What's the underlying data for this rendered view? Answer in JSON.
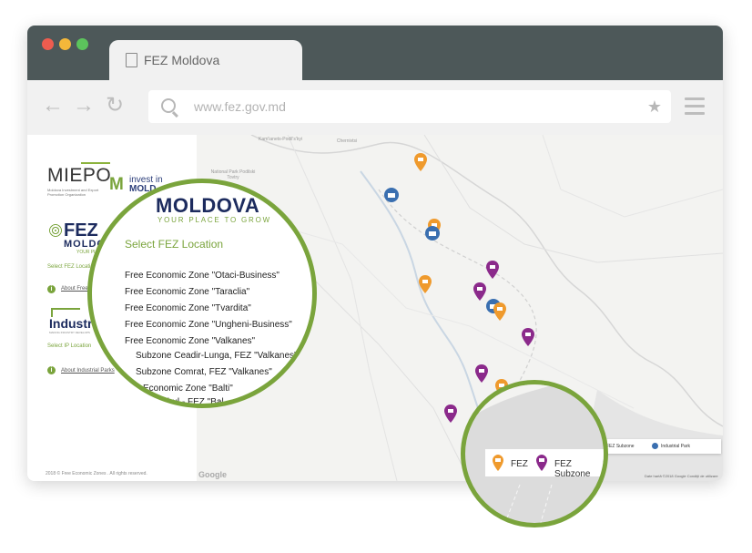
{
  "browser": {
    "tab_title": "FEZ Moldova",
    "url": "www.fez.gov.md",
    "dot_colors": [
      "#ee5c4f",
      "#f4b73a",
      "#5cc45c"
    ]
  },
  "sidebar": {
    "miepo_logo": "MIEPO",
    "miepo_subtitle": "Moldova Investment and Export Promotion Organization",
    "invest_logo_line1": "invest in",
    "invest_logo_line2": "MOLD",
    "fez_logo": "FEZ",
    "fez_logo_country": "MOLDO",
    "fez_logo_tagline": "YOUR PLACE",
    "select_fez_label": "Select FEZ Locati",
    "about_fez_link": "About Free",
    "industrial_logo": "Industrial",
    "industrial_subtitle": "MAKING INDUSTRY DEVELOPS",
    "select_ip_label": "Select IP Location",
    "about_ip_link": "About Industrial Parks",
    "footer": "2018 © Free Economic Zones . All rights reserved."
  },
  "map": {
    "labels": [
      "Kam'ianets-Podil's'kyi",
      "National Park Podilski Tovtry",
      "Chernivtsi"
    ],
    "legend_small": {
      "subzone": "FEZ Subzone",
      "industrial_park": "Industrial Park"
    },
    "google": "Google",
    "attribution": "Date hartă ©2018 Google    Condiţii de utilizare",
    "colors": {
      "fez": "#ef9a2d",
      "subzone": "#8b2a8b",
      "industrial_park": "#3a6fb0",
      "accent": "#7aa43c"
    }
  },
  "magnifier_left": {
    "moldova": "MOLDOVA",
    "tagline": "YOUR PLACE TO GROW",
    "select_title": "Select FEZ Location",
    "items": [
      "Free Economic Zone \"Otaci-Business\"",
      "Free Economic Zone \"Taraclia\"",
      "Free Economic Zone \"Tvardita\"",
      "Free Economic Zone \"Ungheni-Business\"",
      "Free Economic Zone \"Valkanes\"",
      "Subzone Ceadir-Lunga, FEZ \"Valkanes\"",
      "Subzone Comrat, FEZ \"Valkanes\"",
      "Economic Zone \"Balti\"",
      "Cahul - FEZ \"Bal"
    ]
  },
  "magnifier_right": {
    "fez_label": "FEZ",
    "subzone_label": "FEZ Subzone"
  }
}
